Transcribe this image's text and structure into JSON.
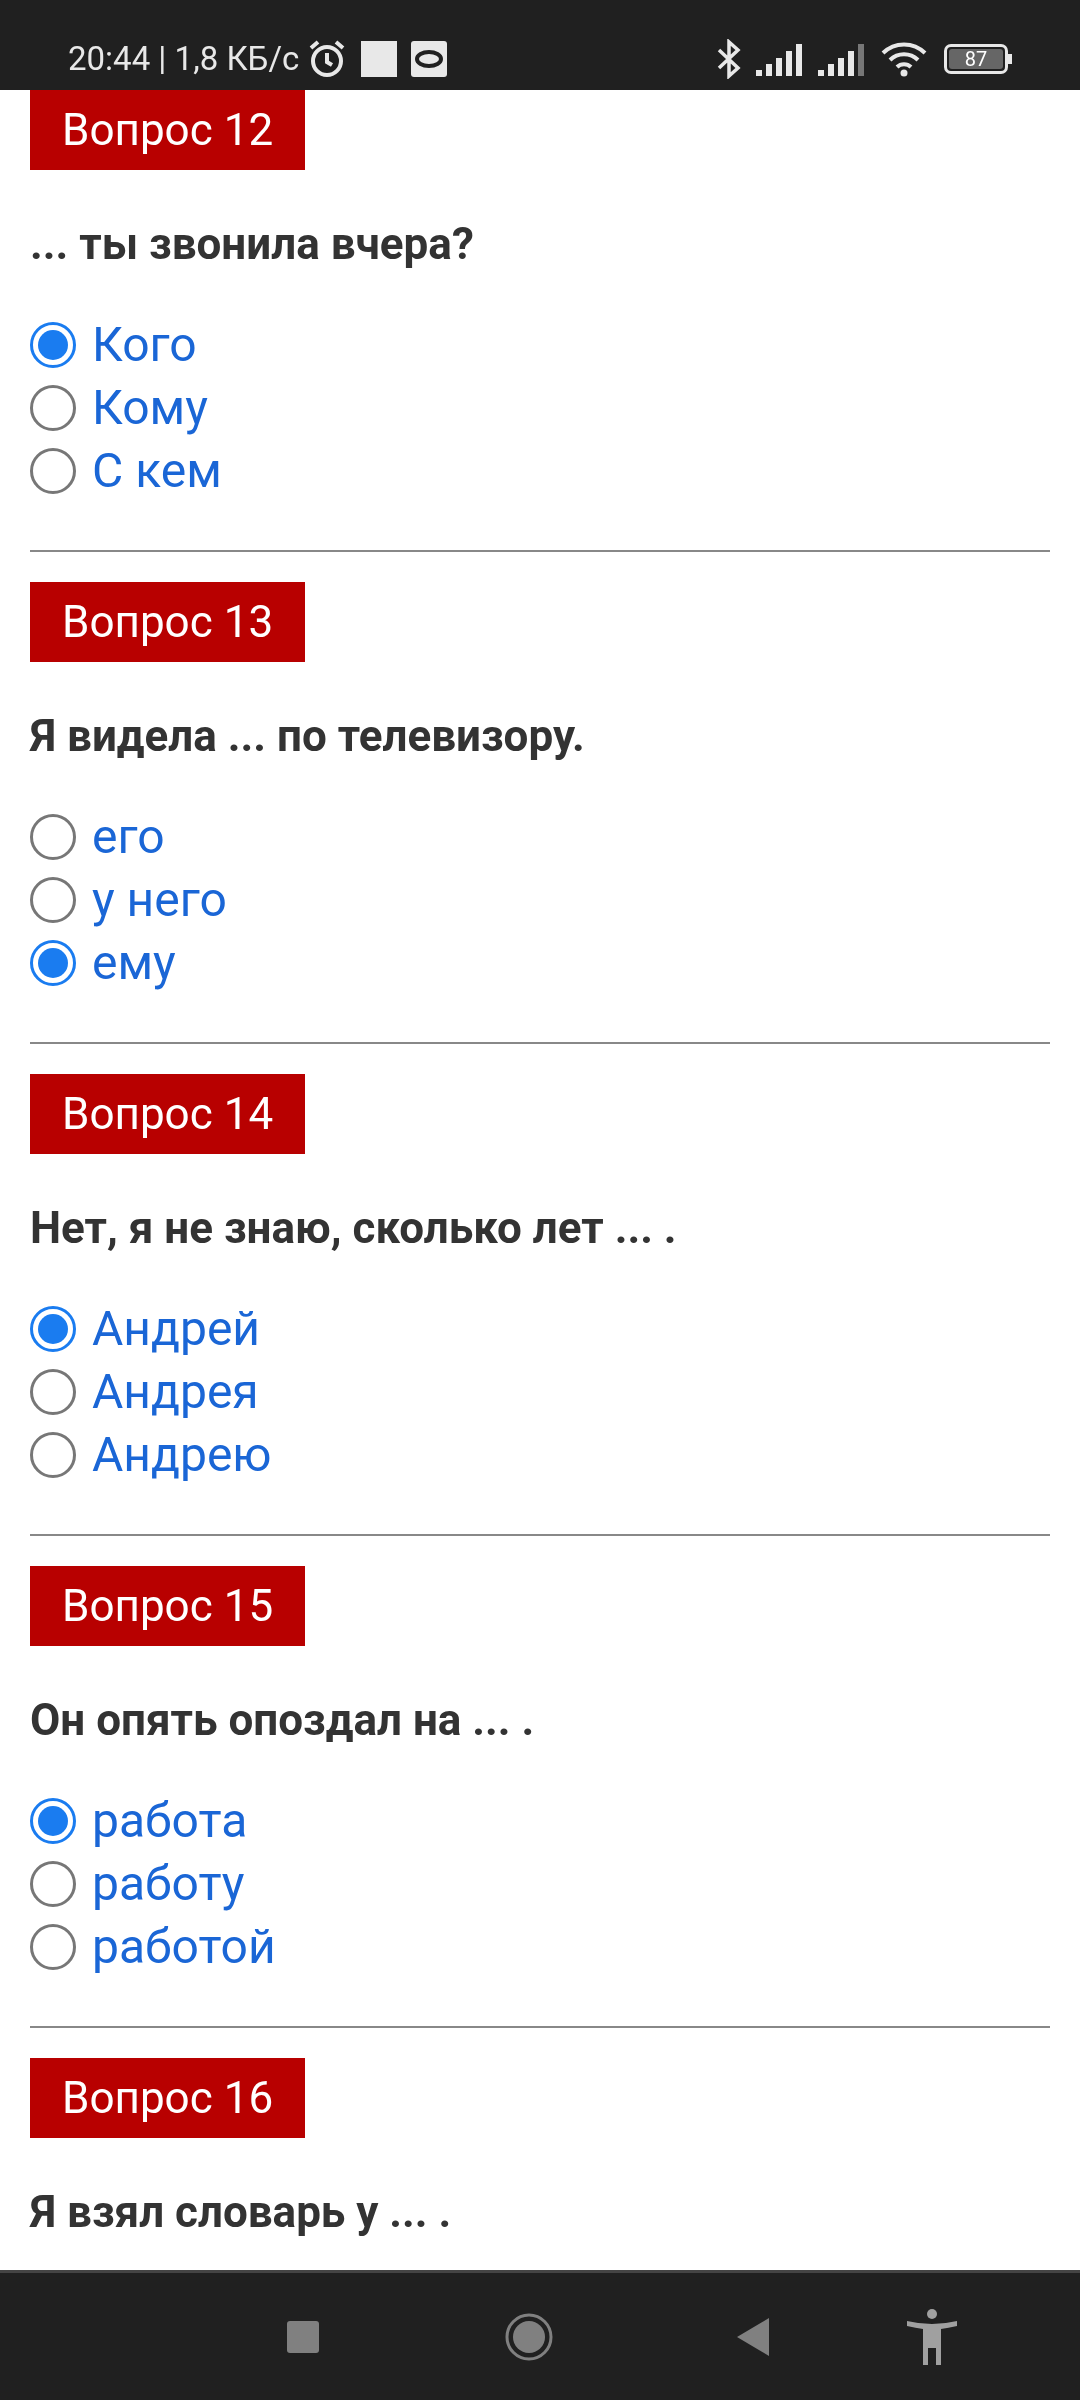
{
  "status_bar": {
    "time_and_speed": "20:44 | 1,8 КБ/с",
    "battery": "87"
  },
  "questions": [
    {
      "badge": "Вопрос 12",
      "text": "... ты звонила вчера?",
      "options": [
        {
          "label": "Кого",
          "selected": true
        },
        {
          "label": "Кому",
          "selected": false
        },
        {
          "label": "С кем",
          "selected": false
        }
      ]
    },
    {
      "badge": "Вопрос 13",
      "text": "Я видела ... по телевизору.",
      "options": [
        {
          "label": "его",
          "selected": false
        },
        {
          "label": "у него",
          "selected": false
        },
        {
          "label": "ему",
          "selected": true
        }
      ]
    },
    {
      "badge": "Вопрос 14",
      "text": "Нет, я не знаю, сколько лет ... .",
      "options": [
        {
          "label": "Андрей",
          "selected": true
        },
        {
          "label": "Андрея",
          "selected": false
        },
        {
          "label": "Андрею",
          "selected": false
        }
      ]
    },
    {
      "badge": "Вопрос 15",
      "text": "Он опять опоздал на ... .",
      "options": [
        {
          "label": "работа",
          "selected": true
        },
        {
          "label": "работу",
          "selected": false
        },
        {
          "label": "работой",
          "selected": false
        }
      ]
    },
    {
      "badge": "Вопрос 16",
      "text": "Я взял словарь у ... ."
    }
  ]
}
